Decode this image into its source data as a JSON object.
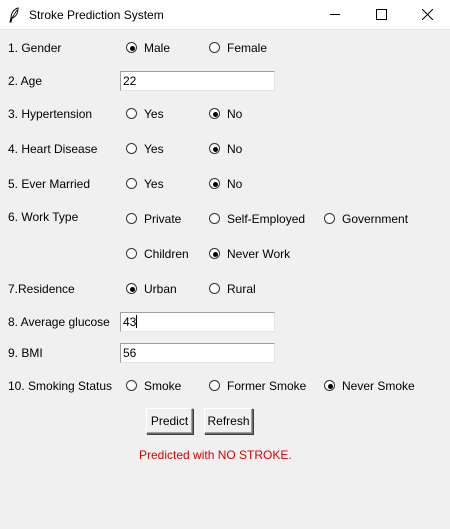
{
  "window": {
    "title": "Stroke Prediction System",
    "icon": "feather-icon"
  },
  "form": {
    "gender": {
      "label": "1. Gender",
      "options": [
        "Male",
        "Female"
      ],
      "selected": "Male"
    },
    "age": {
      "label": "2. Age",
      "value": "22"
    },
    "hypertension": {
      "label": "3. Hypertension",
      "options": [
        "Yes",
        "No"
      ],
      "selected": "No"
    },
    "heart_disease": {
      "label": "4. Heart Disease",
      "options": [
        "Yes",
        "No"
      ],
      "selected": "No"
    },
    "ever_married": {
      "label": "5. Ever Married",
      "options": [
        "Yes",
        "No"
      ],
      "selected": "No"
    },
    "work_type": {
      "label": "6. Work Type",
      "options": [
        "Private",
        "Self-Employed",
        "Government",
        "Children",
        "Never Work"
      ],
      "selected": "Never Work"
    },
    "residence": {
      "label": "7.Residence",
      "options": [
        "Urban",
        "Rural"
      ],
      "selected": "Urban"
    },
    "glucose": {
      "label": "8. Average glucose",
      "value": "43"
    },
    "bmi": {
      "label": "9. BMI",
      "value": "56"
    },
    "smoking": {
      "label": "10. Smoking Status",
      "options": [
        "Smoke",
        "Former Smoke",
        "Never Smoke"
      ],
      "selected": "Never Smoke"
    }
  },
  "buttons": {
    "predict": "Predict",
    "refresh": "Refresh"
  },
  "result": {
    "text": "Predicted with NO STROKE.",
    "color": "#e00000"
  }
}
